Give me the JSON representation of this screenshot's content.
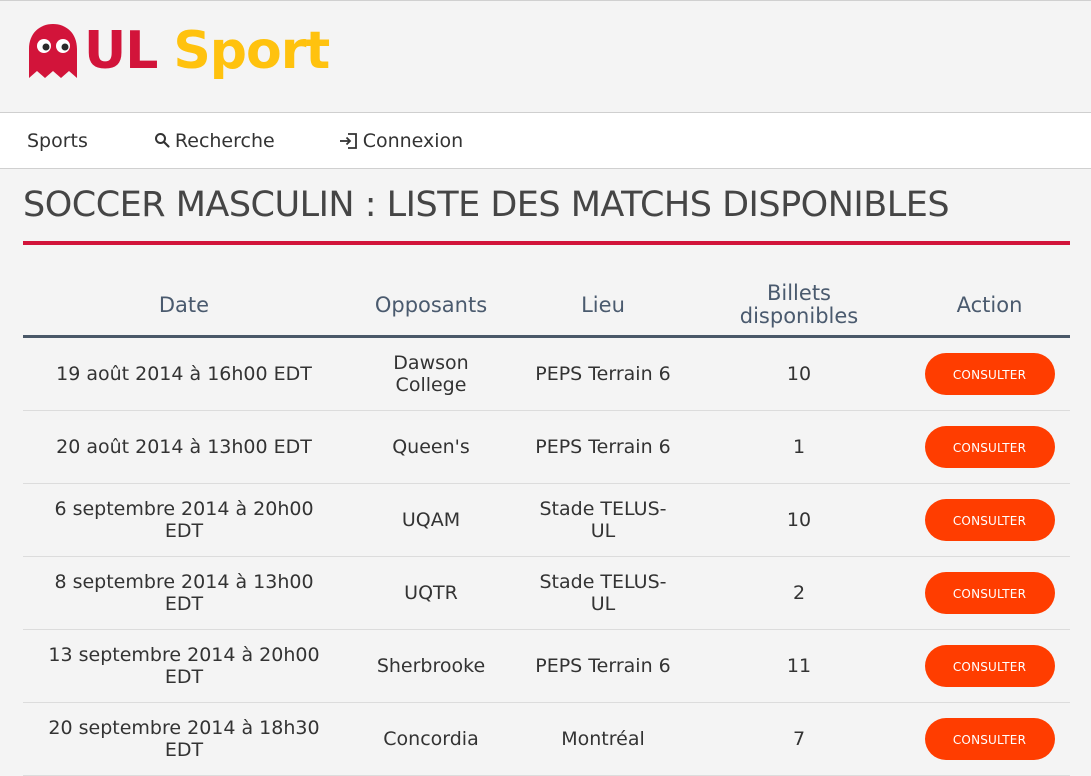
{
  "brand": {
    "name_part1": "UL",
    "name_part2": "Sport",
    "colors": {
      "red": "#d2143a",
      "yellow": "#ffc20e"
    }
  },
  "nav": {
    "sports_label": "Sports",
    "search_label": "Recherche",
    "login_label": "Connexion"
  },
  "page": {
    "title": "SOCCER MASCULIN : LISTE DES MATCHS DISPONIBLES",
    "accent_color": "#d2143a"
  },
  "table": {
    "headers": {
      "date": "Date",
      "opponents": "Opposants",
      "venue": "Lieu",
      "tickets_line1": "Billets",
      "tickets_line2": "disponibles",
      "action": "Action"
    },
    "rows": [
      {
        "date_line1": "19 août 2014 à 16h00 EDT",
        "date_line2": "",
        "opp_line1": "Dawson",
        "opp_line2": "College",
        "venue_line1": "PEPS Terrain 6",
        "venue_line2": "",
        "tickets": "10",
        "action": "Consulter"
      },
      {
        "date_line1": "20 août 2014 à 13h00 EDT",
        "date_line2": "",
        "opp_line1": "Queen's",
        "opp_line2": "",
        "venue_line1": "PEPS Terrain 6",
        "venue_line2": "",
        "tickets": "1",
        "action": "Consulter"
      },
      {
        "date_line1": "6 septembre 2014 à 20h00",
        "date_line2": "EDT",
        "opp_line1": "UQAM",
        "opp_line2": "",
        "venue_line1": "Stade TELUS-",
        "venue_line2": "UL",
        "tickets": "10",
        "action": "Consulter"
      },
      {
        "date_line1": "8 septembre 2014 à 13h00",
        "date_line2": "EDT",
        "opp_line1": "UQTR",
        "opp_line2": "",
        "venue_line1": "Stade TELUS-",
        "venue_line2": "UL",
        "tickets": "2",
        "action": "Consulter"
      },
      {
        "date_line1": "13 septembre 2014 à 20h00",
        "date_line2": "EDT",
        "opp_line1": "Sherbrooke",
        "opp_line2": "",
        "venue_line1": "PEPS Terrain 6",
        "venue_line2": "",
        "tickets": "11",
        "action": "Consulter"
      },
      {
        "date_line1": "20 septembre 2014 à 18h30",
        "date_line2": "EDT",
        "opp_line1": "Concordia",
        "opp_line2": "",
        "venue_line1": "Montréal",
        "venue_line2": "",
        "tickets": "7",
        "action": "Consulter"
      }
    ],
    "button_color": "#ff3d00"
  },
  "icons": {
    "logo": "ghost-icon",
    "search": "search-icon",
    "login": "login-icon"
  }
}
